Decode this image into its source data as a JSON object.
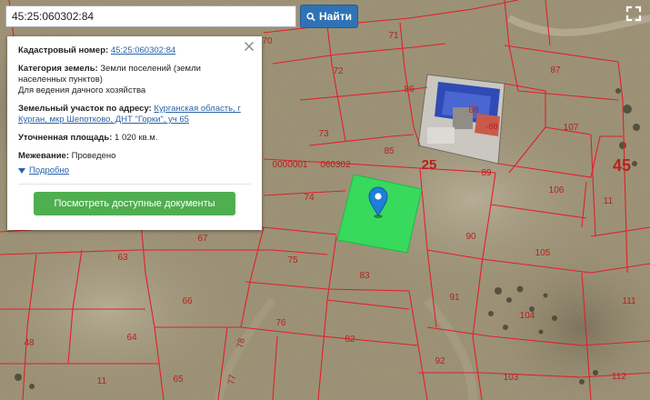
{
  "search": {
    "value": "45:25:060302:84",
    "button_label": "Найти"
  },
  "info_card": {
    "cadastral_label": "Кадастровый номер:",
    "cadastral_value": "45:25:060302:84",
    "category_label": "Категория земель:",
    "category_value": "Земли поселений (земли населенных пунктов)",
    "permitted_use": "Для ведения дачного хозяйства",
    "address_label": "Земельный участок по адресу:",
    "address_value": "Курганская область, г Курган, мкр Шепотково, ДНТ \"Горки\", уч 65",
    "area_label": "Уточненная площадь:",
    "area_value": "1 020 кв.м.",
    "survey_label": "Межевание:",
    "survey_value": "Проведено",
    "details_link": "Подробно",
    "documents_button": "Посмотреть доступные документы"
  },
  "map": {
    "parcel_numbers": [
      "70",
      "71",
      "72",
      "86",
      "87",
      "88",
      "73",
      "85",
      "107",
      "89",
      "106",
      "74",
      "90",
      "11",
      "67",
      "63",
      "105",
      "75",
      "83",
      "66",
      "91",
      "111",
      "76",
      "104",
      "64",
      "82",
      "48",
      "78",
      "77",
      "92",
      "11",
      "65",
      "103",
      "112"
    ],
    "quarter_labels": [
      "25",
      "45"
    ],
    "block_codes": [
      "0000001",
      "060302"
    ],
    "small_label": "-88",
    "colors": {
      "parcel_line": "#e0202a",
      "selected_parcel": "#2ee05a",
      "marker": "#1f7fd8",
      "label_text": "#b4221f"
    }
  }
}
